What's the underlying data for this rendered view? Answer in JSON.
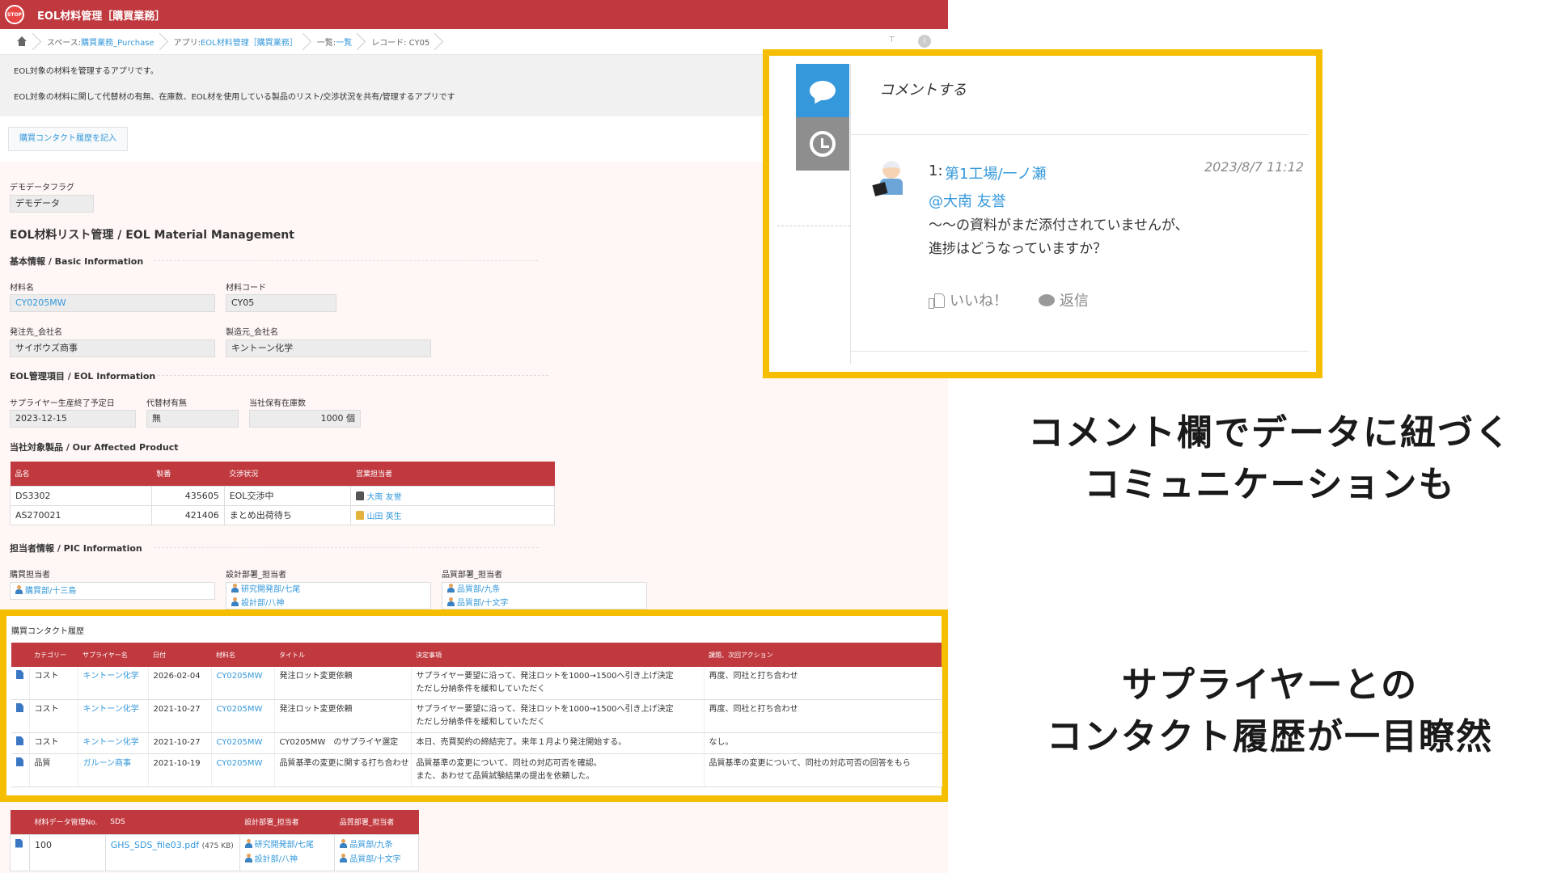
{
  "app": {
    "title": "EOL材料管理［購買業務］",
    "stop_label": "STOP"
  },
  "breadcrumb": {
    "space_prefix": "スペース: ",
    "space": "購買業務_Purchase",
    "app_prefix": "アプリ: ",
    "app": "EOL材料管理［購買業務］",
    "list_prefix": "一覧: ",
    "list": "一覧",
    "record": "レコード: CY05"
  },
  "description": {
    "line1": "EOL対象の材料を管理するアプリです。",
    "line2": "EOL対象の材料に関して代替材の有無、在庫数、EOL材を使用している製品のリスト/交渉状況を共有/管理するアプリです"
  },
  "actions": {
    "contact_button": "購買コンタクト履歴を記入"
  },
  "record": {
    "demo_flag_label": "デモデータフラグ",
    "demo_flag_value": "デモデータ",
    "main_title": "EOL材料リスト管理 / EOL Material Management",
    "basic_header": "基本情報 / Basic Information",
    "material_name_label": "材料名",
    "material_name": "CY0205MW",
    "material_code_label": "材料コード",
    "material_code": "CY05",
    "supplier_label": "発注先_会社名",
    "supplier": "サイボウズ商事",
    "maker_label": "製造元_会社名",
    "maker": "キントーン化学",
    "eol_header": "EOL管理項目 / EOL Information",
    "end_date_label": "サプライヤー生産終了予定日",
    "end_date": "2023-12-15",
    "alt_label": "代替材有無",
    "alt": "無",
    "stock_label": "当社保有在庫数",
    "stock": "1000 個",
    "affected_header": "当社対象製品 / Our Affected Product",
    "affected_columns": [
      "品名",
      "製番",
      "交渉状況",
      "営業担当者"
    ],
    "affected_rows": [
      {
        "name": "DS3302",
        "no": "435605",
        "status": "EOL交渉中",
        "person": "大南 友誉"
      },
      {
        "name": "AS270021",
        "no": "421406",
        "status": "まとめ出荷待ち",
        "person": "山田 英生"
      }
    ],
    "pic_header": "担当者情報 / PIC Information",
    "buyer_label": "購買担当者",
    "buyer": "購買部/十三島",
    "design_label": "設計部署_担当者",
    "design1": "研究開発部/七尾",
    "design2": "設計部/八神",
    "quality_label": "品質部署_担当者",
    "quality1": "品質部/九条",
    "quality2": "品質部/十文字"
  },
  "history": {
    "title": "購買コンタクト履歴",
    "columns": [
      "カテゴリー",
      "サプライヤー名",
      "日付",
      "材料名",
      "タイトル",
      "決定事項",
      "課題、次回アクション"
    ],
    "rows": [
      {
        "cat": "コスト",
        "supplier": "キントーン化学",
        "date": "2026-02-04",
        "material": "CY0205MW",
        "title": "発注ロット変更依頼",
        "decision1": "サプライヤー要望に沿って、発注ロットを1000→1500へ引き上げ決定",
        "decision2": "ただし分納条件を緩和していただく",
        "next": "再度、同社と打ち合わせ"
      },
      {
        "cat": "コスト",
        "supplier": "キントーン化学",
        "date": "2021-10-27",
        "material": "CY0205MW",
        "title": "発注ロット変更依頼",
        "decision1": "サプライヤー要望に沿って、発注ロットを1000→1500へ引き上げ決定",
        "decision2": "ただし分納条件を緩和していただく",
        "next": "再度、同社と打ち合わせ"
      },
      {
        "cat": "コスト",
        "supplier": "キントーン化学",
        "date": "2021-10-27",
        "material": "CY0205MW",
        "title": "CY0205MW　のサプライヤ選定",
        "decision1": "本日、売買契約の締結完了。来年１月より発注開始する。",
        "decision2": "",
        "next": "なし。"
      },
      {
        "cat": "品質",
        "supplier": "ガルーン商事",
        "date": "2021-10-19",
        "material": "CY0205MW",
        "title": "品質基準の変更に関する打ち合わせ",
        "decision1": "品質基準の変更について、同社の対応可否を確認。",
        "decision2": "また、あわせて品質試験結果の提出を依頼した。",
        "next": "品質基準の変更について、同社の対応可否の回答をもら"
      }
    ]
  },
  "materials": {
    "columns": [
      "材料データ管理No.",
      "SDS",
      "設計部署_担当者",
      "品質部署_担当者"
    ],
    "rows": [
      {
        "no": "100",
        "sds": "GHS_SDS_file03.pdf",
        "size": "(475 KB)",
        "design1": "研究開発部/七尾",
        "design2": "設計部/八神",
        "quality1": "品質部/九条",
        "quality2": "品質部/十文字"
      }
    ]
  },
  "comments": {
    "input_placeholder": "コメントする",
    "items": [
      {
        "num": "1:",
        "author": "第1工場/一ノ瀬",
        "date": "2023/8/7 11:12",
        "mention": "@大南 友誉",
        "line1": "～～の資料がまだ添付されていませんが、",
        "line2": "進捗はどうなっていますか？",
        "like": "いいね！",
        "reply": "返信"
      }
    ]
  },
  "captions": {
    "comment_line1": "コメント欄でデータに紐づく",
    "comment_line2": "コミュニケーションも",
    "history_line1": "サプライヤーとの",
    "history_line2": "コンタクト履歴が一目瞭然"
  },
  "colors": {
    "header_red": "#c0393f",
    "highlight": "#f6be00",
    "link": "#3498db"
  }
}
